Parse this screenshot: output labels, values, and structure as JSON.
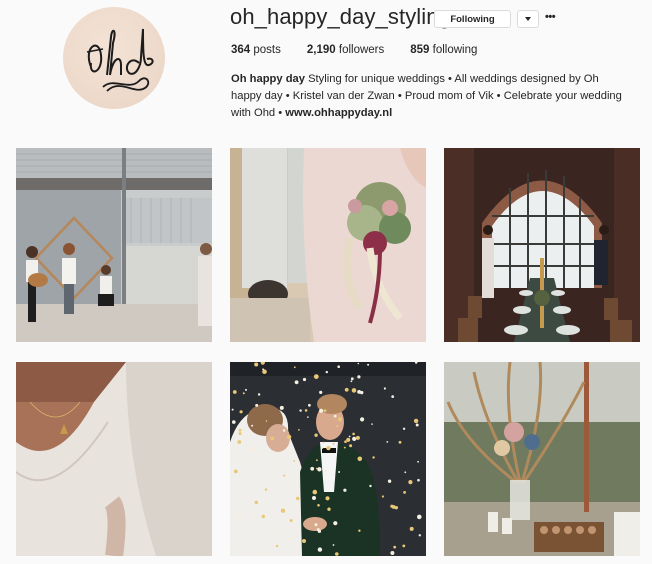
{
  "profile": {
    "username": "oh_happy_day_styling",
    "avatar_text": "Ohd",
    "following_button": "Following",
    "dropdown_icon": "caret-down-icon",
    "more_icon": "ellipsis-icon",
    "more_label": "•••"
  },
  "stats": [
    {
      "count": "364",
      "label": "posts"
    },
    {
      "count": "2,190",
      "label": "followers"
    },
    {
      "count": "859",
      "label": "following"
    }
  ],
  "bio": {
    "name": "Oh happy day",
    "text": " Styling for unique weddings • All weddings designed by Oh happy day • Kristel van der Zwan • Proud mom of Vik • Celebrate your wedding with Ohd • ",
    "link": "www.ohhappyday.nl"
  },
  "posts": [
    {
      "id": "post-1",
      "description": "band playing in front of warehouse with geometric frame"
    },
    {
      "id": "post-2",
      "description": "couple holding dried flower bouquet"
    },
    {
      "id": "post-3",
      "description": "long dinner table under arched brick window"
    },
    {
      "id": "post-4",
      "description": "close-up of necklace on woman in white top"
    },
    {
      "id": "post-5",
      "description": "bride and groom in confetti"
    },
    {
      "id": "post-6",
      "description": "dried flower arrangement with candles"
    }
  ]
}
